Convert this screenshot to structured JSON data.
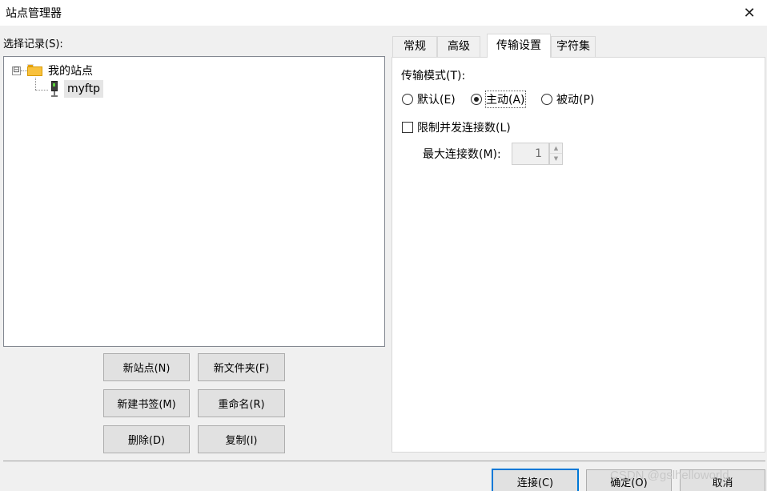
{
  "window": {
    "title": "站点管理器",
    "close_icon": "close-icon"
  },
  "left": {
    "select_label": "选择记录(S):",
    "tree": {
      "root": {
        "label": "我的站点",
        "icon": "folder-icon",
        "expander": "⊟"
      },
      "items": [
        {
          "label": "myftp",
          "icon": "server-icon",
          "selected": true
        }
      ]
    },
    "buttons": {
      "new_site": "新站点(N)",
      "new_folder": "新文件夹(F)",
      "new_bookmark": "新建书签(M)",
      "rename": "重命名(R)",
      "delete": "删除(D)",
      "copy": "复制(I)"
    }
  },
  "tabs": [
    {
      "label": "常规",
      "active": false
    },
    {
      "label": "高级",
      "active": false
    },
    {
      "label": "传输设置",
      "active": true
    },
    {
      "label": "字符集",
      "active": false
    }
  ],
  "transfer": {
    "mode_label": "传输模式(T):",
    "modes": [
      {
        "label": "默认(E)",
        "checked": false
      },
      {
        "label": "主动(A)",
        "checked": true
      },
      {
        "label": "被动(P)",
        "checked": false
      }
    ],
    "limit_label": "限制并发连接数(L)",
    "limit_checked": false,
    "max_label": "最大连接数(M):",
    "max_value": "1"
  },
  "footer": {
    "connect": "连接(C)",
    "ok": "确定(O)",
    "cancel": "取消"
  },
  "watermark": "CSDN @gslhelloworld"
}
